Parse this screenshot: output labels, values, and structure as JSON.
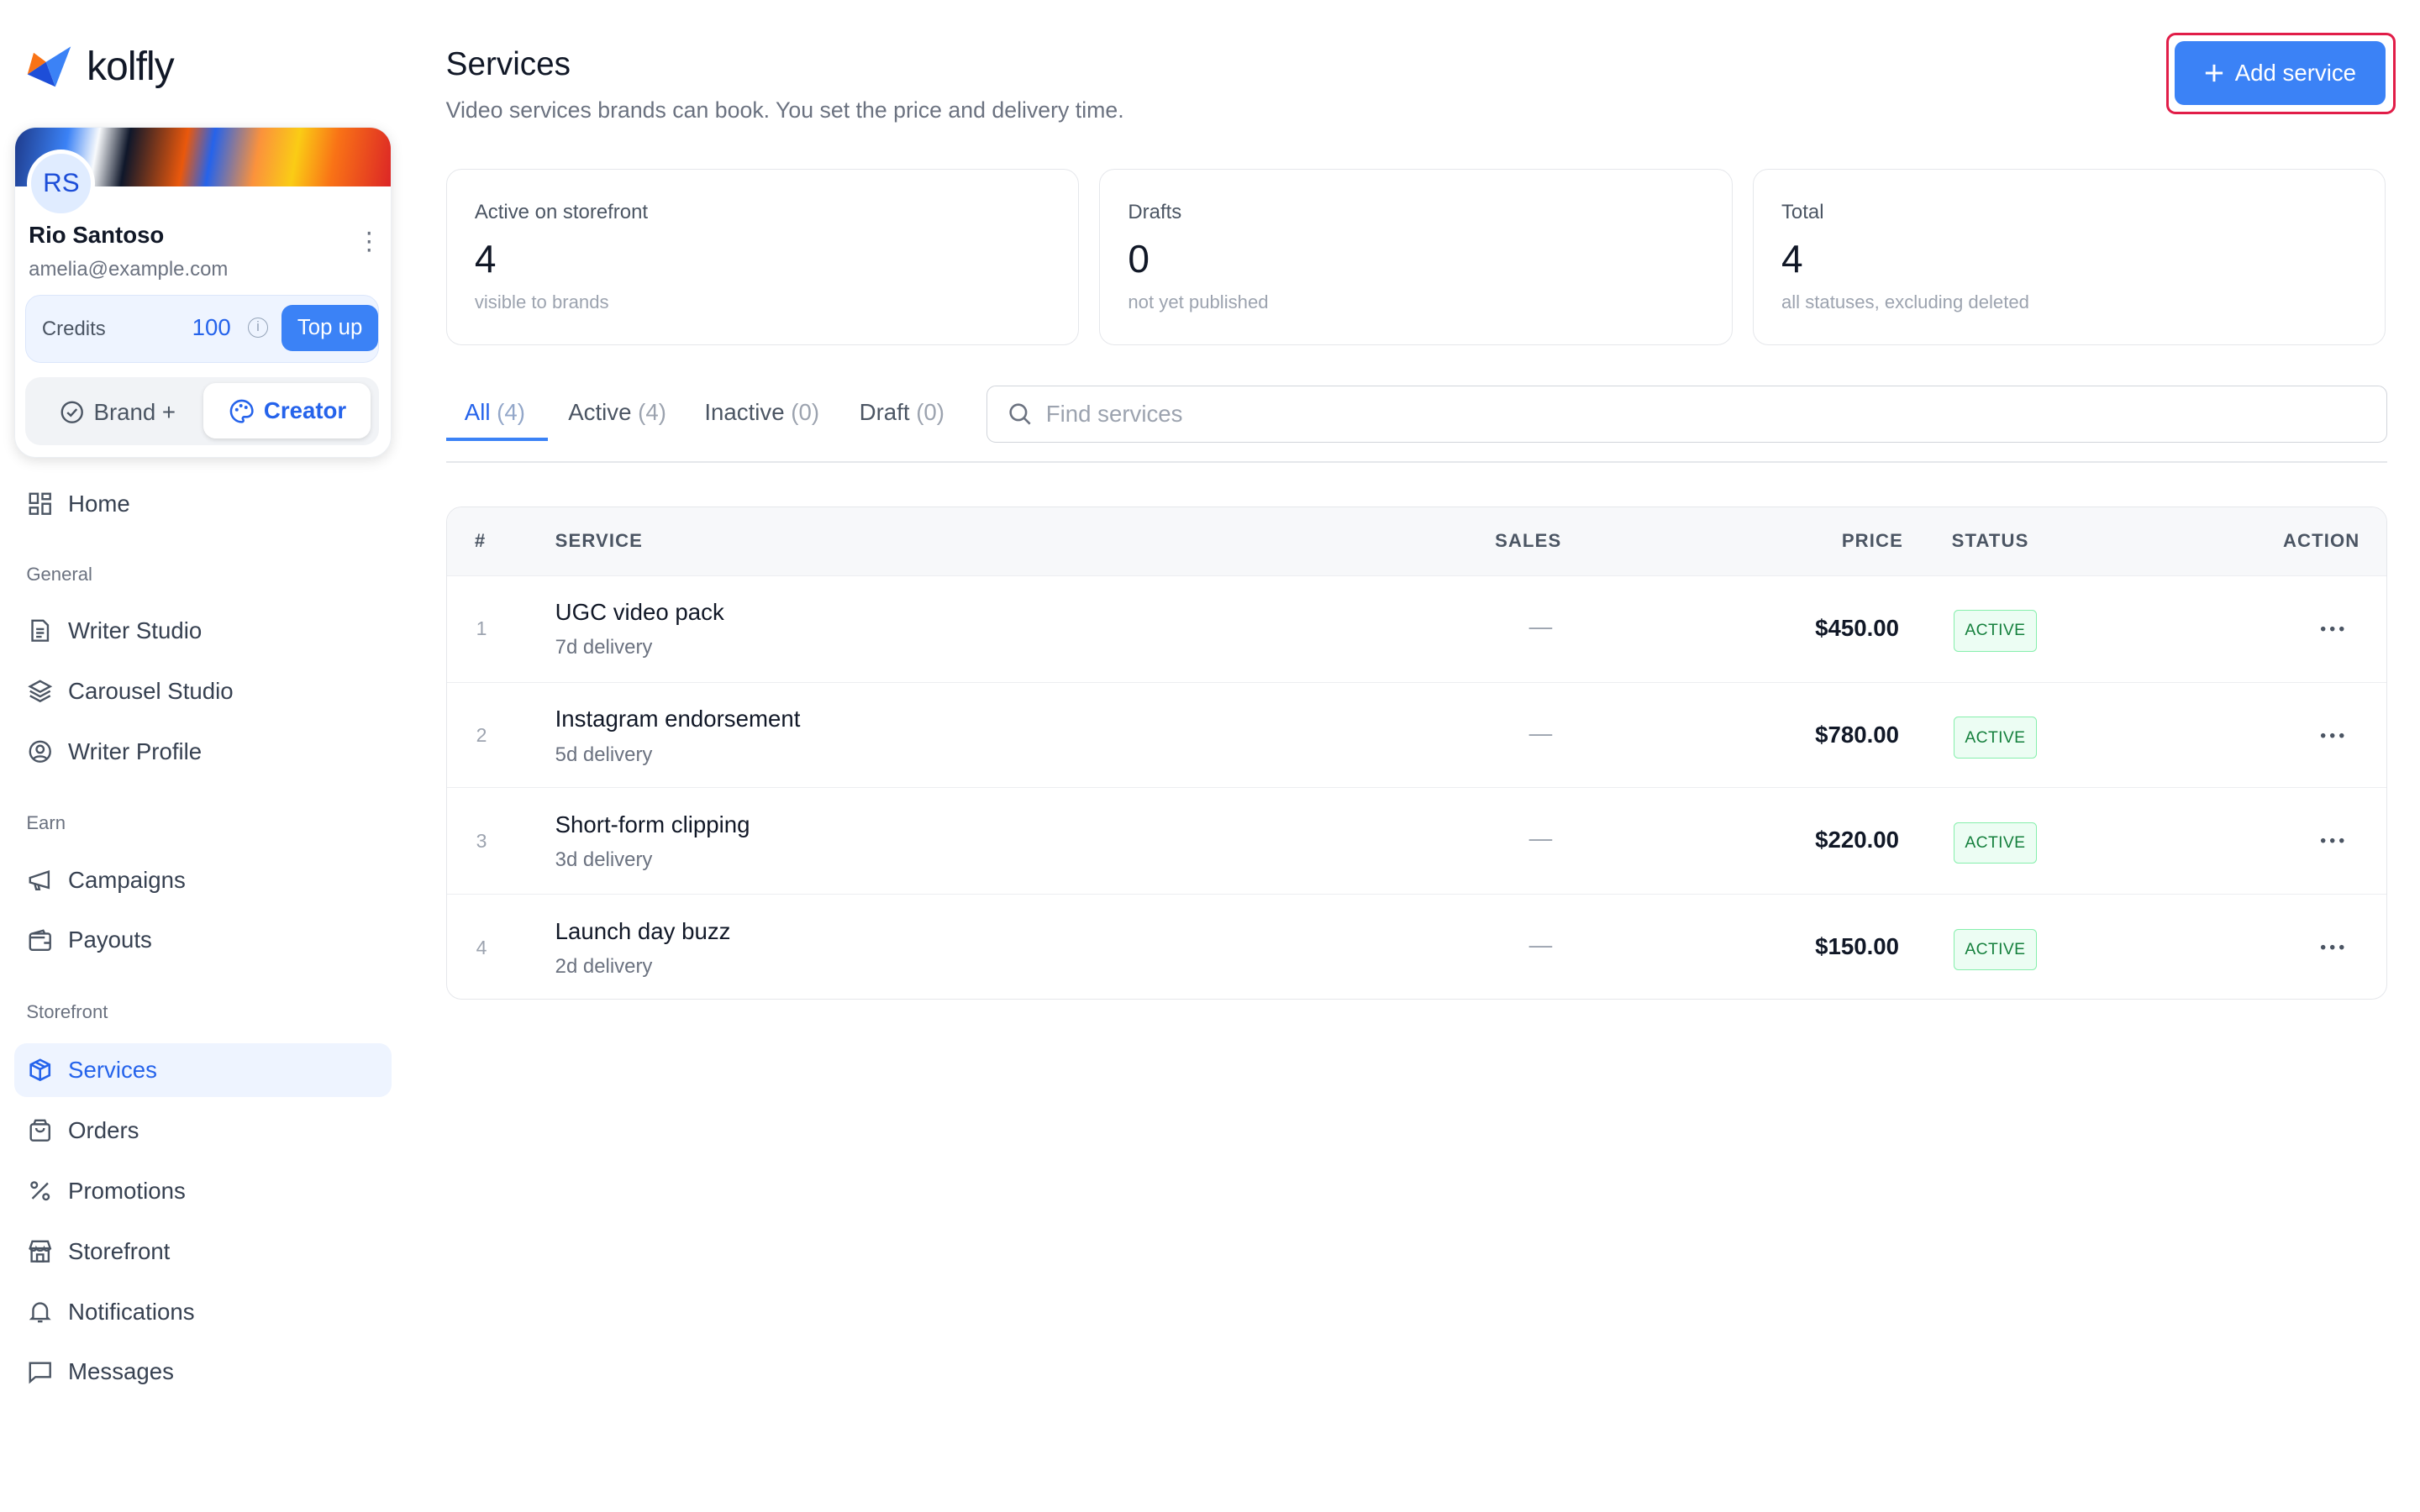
{
  "brand": {
    "name": "kolfly",
    "accent": "#3b82f6"
  },
  "profile": {
    "initials": "RS",
    "name": "Rio Santoso",
    "email": "amelia@example.com",
    "credits_label": "Credits",
    "credits_value": "100",
    "topup_label": "Top up",
    "mode_brand_label": "Brand +",
    "mode_creator_label": "Creator"
  },
  "nav": {
    "home": "Home",
    "section_general": "General",
    "writer_studio": "Writer Studio",
    "carousel_studio": "Carousel Studio",
    "writer_profile": "Writer Profile",
    "section_earn": "Earn",
    "campaigns": "Campaigns",
    "payouts": "Payouts",
    "section_storefront": "Storefront",
    "services": "Services",
    "orders": "Orders",
    "promotions": "Promotions",
    "storefront": "Storefront",
    "notifications": "Notifications",
    "messages": "Messages"
  },
  "header": {
    "title": "Services",
    "subtitle": "Video services brands can book. You set the price and delivery time.",
    "add_label": "Add service"
  },
  "stats": [
    {
      "label": "Active on storefront",
      "value": "4",
      "note": "visible to brands"
    },
    {
      "label": "Drafts",
      "value": "0",
      "note": "not yet published"
    },
    {
      "label": "Total",
      "value": "4",
      "note": "all statuses, excluding deleted"
    }
  ],
  "tabs": [
    {
      "label": "All",
      "count": "(4)"
    },
    {
      "label": "Active",
      "count": "(4)"
    },
    {
      "label": "Inactive",
      "count": "(0)"
    },
    {
      "label": "Draft",
      "count": "(0)"
    }
  ],
  "search": {
    "placeholder": "Find services",
    "value": ""
  },
  "table": {
    "headers": {
      "num": "#",
      "service": "SERVICE",
      "sales": "SALES",
      "price": "PRICE",
      "status": "STATUS",
      "action": "ACTION"
    },
    "rows": [
      {
        "num": "1",
        "name": "UGC video pack",
        "delivery": "7d delivery",
        "sales": "—",
        "price": "$450.00",
        "status": "ACTIVE"
      },
      {
        "num": "2",
        "name": "Instagram endorsement",
        "delivery": "5d delivery",
        "sales": "—",
        "price": "$780.00",
        "status": "ACTIVE"
      },
      {
        "num": "3",
        "name": "Short-form clipping",
        "delivery": "3d delivery",
        "sales": "—",
        "price": "$220.00",
        "status": "ACTIVE"
      },
      {
        "num": "4",
        "name": "Launch day buzz",
        "delivery": "2d delivery",
        "sales": "—",
        "price": "$150.00",
        "status": "ACTIVE"
      }
    ]
  }
}
